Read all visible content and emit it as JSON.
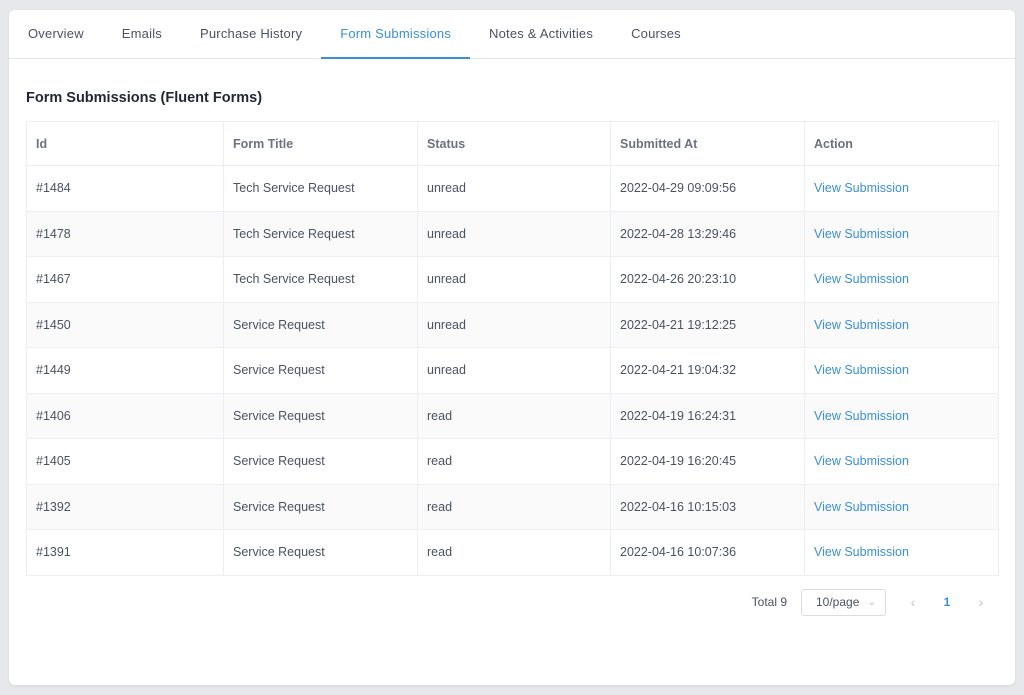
{
  "tabs": [
    {
      "label": "Overview",
      "active": false
    },
    {
      "label": "Emails",
      "active": false
    },
    {
      "label": "Purchase History",
      "active": false
    },
    {
      "label": "Form Submissions",
      "active": true
    },
    {
      "label": "Notes & Activities",
      "active": false
    },
    {
      "label": "Courses",
      "active": false
    }
  ],
  "section_title": "Form Submissions (Fluent Forms)",
  "table": {
    "headers": [
      "Id",
      "Form Title",
      "Status",
      "Submitted At",
      "Action"
    ],
    "rows": [
      {
        "id": "#1484",
        "form_title": "Tech Service Request",
        "status": "unread",
        "submitted_at": "2022-04-29 09:09:56",
        "action": "View Submission"
      },
      {
        "id": "#1478",
        "form_title": "Tech Service Request",
        "status": "unread",
        "submitted_at": "2022-04-28 13:29:46",
        "action": "View Submission"
      },
      {
        "id": "#1467",
        "form_title": "Tech Service Request",
        "status": "unread",
        "submitted_at": "2022-04-26 20:23:10",
        "action": "View Submission"
      },
      {
        "id": "#1450",
        "form_title": "Service Request",
        "status": "unread",
        "submitted_at": "2022-04-21 19:12:25",
        "action": "View Submission"
      },
      {
        "id": "#1449",
        "form_title": "Service Request",
        "status": "unread",
        "submitted_at": "2022-04-21 19:04:32",
        "action": "View Submission"
      },
      {
        "id": "#1406",
        "form_title": "Service Request",
        "status": "read",
        "submitted_at": "2022-04-19 16:24:31",
        "action": "View Submission"
      },
      {
        "id": "#1405",
        "form_title": "Service Request",
        "status": "read",
        "submitted_at": "2022-04-19 16:20:45",
        "action": "View Submission"
      },
      {
        "id": "#1392",
        "form_title": "Service Request",
        "status": "read",
        "submitted_at": "2022-04-16 10:15:03",
        "action": "View Submission"
      },
      {
        "id": "#1391",
        "form_title": "Service Request",
        "status": "read",
        "submitted_at": "2022-04-16 10:07:36",
        "action": "View Submission"
      }
    ]
  },
  "pagination": {
    "total_label": "Total 9",
    "page_size": "10/page",
    "current_page": "1",
    "prev_icon": "chevron-left-icon",
    "next_icon": "chevron-right-icon",
    "dropdown_icon": "chevron-down-icon"
  },
  "colors": {
    "accent": "#3a8fd6",
    "background": "#e6e8ec"
  }
}
